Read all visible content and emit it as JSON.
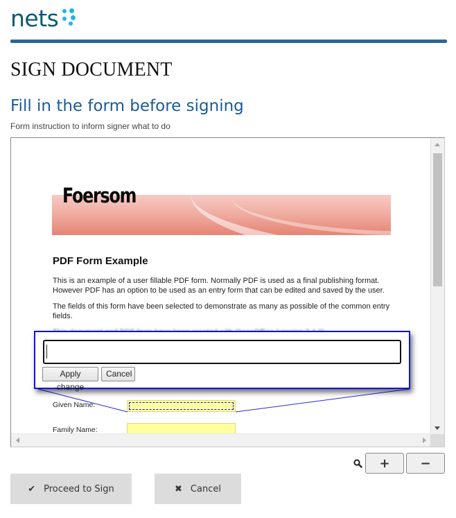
{
  "brand": {
    "logo_text": "nets",
    "logo_icon": "nets-dots-icon",
    "colors": {
      "logo_text": "#0d5a73",
      "logo_dots": "#22b3ea",
      "rule": "#2d6694",
      "section_title": "#1b5b96",
      "popup_border": "#1212dc",
      "form_field": "#ffff9e"
    }
  },
  "page": {
    "title": "SIGN DOCUMENT",
    "section_title": "Fill in the form before signing",
    "instruction": "Form instruction to inform signer what to do"
  },
  "document": {
    "banner_title": "Foersom",
    "heading": "PDF Form Example",
    "paragraphs": [
      "This is an example of a user fillable PDF form. Normally PDF is used as a final publishing format. However PDF has an option to be used as an entry form that can be edited and saved by the user.",
      "The fields of this form have been selected to demonstrate as many as possible of the common entry fields."
    ],
    "obscured_line": "This document and PDF form have been created with OpenOffice (version 3.4.0).",
    "fields": [
      {
        "label": "Given Name:",
        "value": ""
      },
      {
        "label": "Family Name:",
        "value": ""
      }
    ]
  },
  "popup": {
    "input_value": "",
    "apply_label": "Apply change",
    "cancel_label": "Cancel"
  },
  "zoom_controls": {
    "icon": "search-icon",
    "zoom_in_label": "+",
    "zoom_out_label": "−"
  },
  "actions": {
    "proceed_icon": "✔",
    "proceed_label": "Proceed to Sign",
    "cancel_icon": "✖",
    "cancel_label": "Cancel"
  }
}
